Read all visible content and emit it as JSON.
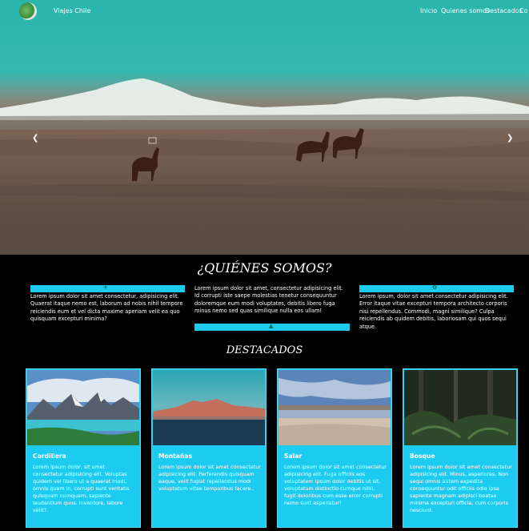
{
  "navbar": {
    "brand": "Viajes Chile",
    "links": [
      "Inicio",
      "Quienes somos",
      "Destacados",
      "Co"
    ]
  },
  "carousel": {
    "prev_icon": "chevron-left-icon",
    "next_icon": "chevron-right-icon"
  },
  "about": {
    "title": "¿QUIÉNES SOMOS?",
    "columns": [
      {
        "icon": "plane-icon",
        "text": "Lorem ipsum dolor sit amet consectetur, adipisicing elit. Quaerat itaque nemo est, laborum ad nobis nihil tempore reiciendis eum et vel dicta maxime aperiam velit ea quo quisquam excepturi minima?"
      },
      {
        "icon": "mountain-icon",
        "text": "Lorem ipsum dolor sit amet, consectetur adipisicing elit. Id corrupti iste saepe molestias tenetur consequuntur doloremque eum modi voluptates, debitis libero fuga minus nemo sed quas similique nulla eos ullam!"
      },
      {
        "icon": "leaf-icon",
        "text": "Lorem ipsum, dolor sit amet consectetur adipisicing elit. Error itaque vitae excepturi tempora architecto corporis nisi repellendus. Commodi, magni similique? Culpa reiciendis ab quidem debitis, laboriosam qui quos sequi atque."
      }
    ]
  },
  "featured": {
    "title": "DESTACADOS",
    "cards": [
      {
        "title": "Cordillera",
        "text": "Lorem ipsum dolor, sit amet consectetur adipisicing elit. Voluptas quidem vel libero ut a quaerat modi, omnis quam in, corrupti sunt veritatis quisquam numquam, sapiente laudantium quos. Inventore, labore velit?."
      },
      {
        "title": "Montañas",
        "text": "Lorem ipsum dolor sit amet consectetur adipisicing elit. Perferendis quisquam eaque, velit fugiat repellendus modi voluptatum vitae temporibus facere.."
      },
      {
        "title": "Salar",
        "text": "Lorem ipsum dolor sit amet consectetur adipisicing elit. Fuga officiis eos voluptatem ipsum dolor debitis ut sit, voluptatum distinctio cumque nihil, fugit doloribus cum esse error corrupti nemo sunt asperiatur!"
      },
      {
        "title": "Bosque",
        "text": "Lorem ipsum dolor sit amet consectetur adipisicing elit. Minus, asperiores. Non sequi omnis autem expedita consequuntur odit officiis odio ipsa sapiente magnam adipisci beatae minima excepturi officia, cum corporis nesciunt."
      }
    ]
  },
  "colors": {
    "accent": "#1ecbf0",
    "background": "#000000"
  }
}
